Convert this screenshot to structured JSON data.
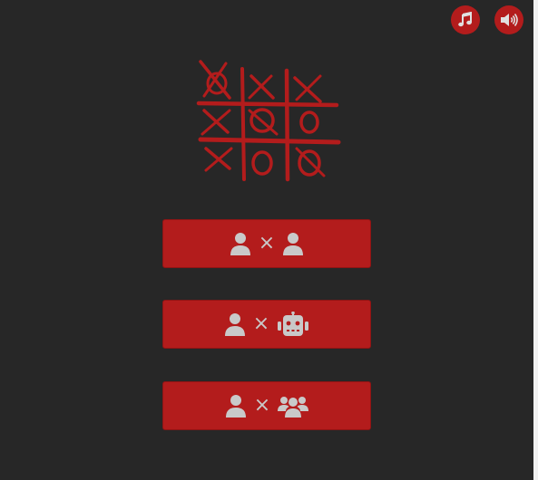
{
  "header": {
    "music_icon": "music-note-icon",
    "sound_icon": "speaker-volume-icon"
  },
  "logo": {
    "icon": "tic-tac-toe-board-icon"
  },
  "modes": [
    {
      "left_icon": "user-icon",
      "separator": "×",
      "right_icon": "user-icon"
    },
    {
      "left_icon": "user-icon",
      "separator": "×",
      "right_icon": "robot-icon"
    },
    {
      "left_icon": "user-icon",
      "separator": "×",
      "right_icon": "users-group-icon"
    }
  ],
  "colors": {
    "background": "#272727",
    "accent": "#b31c1c",
    "icon": "#c9c9c9"
  }
}
